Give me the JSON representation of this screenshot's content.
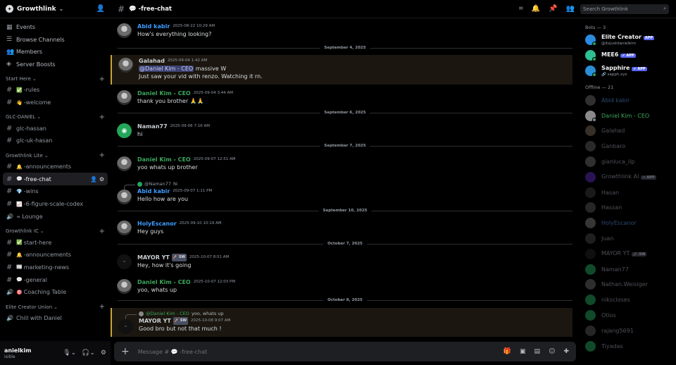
{
  "server": {
    "name": "Growthlink"
  },
  "nav": [
    {
      "label": "Events",
      "icon": "calendar-icon"
    },
    {
      "label": "Browse Channels",
      "icon": "browse-icon"
    },
    {
      "label": "Members",
      "icon": "members-icon"
    },
    {
      "label": "Server Boosts",
      "icon": "boost-icon"
    }
  ],
  "categories": [
    {
      "name": "Start Here",
      "channels": [
        {
          "name": "-rules",
          "emoji": "✅",
          "type": "text"
        },
        {
          "name": "-welcome",
          "emoji": "👋",
          "type": "text"
        }
      ]
    },
    {
      "name": "GLC-DANIEL",
      "channels": [
        {
          "name": "glc-hassan",
          "emoji": "",
          "type": "text"
        },
        {
          "name": "glc-uk-hasan",
          "emoji": "",
          "type": "text"
        }
      ]
    },
    {
      "name": "Growthlink Lite",
      "channels": [
        {
          "name": "-announcements",
          "emoji": "🔔",
          "type": "text"
        },
        {
          "name": "-free-chat",
          "emoji": "💬",
          "type": "text",
          "active": true
        },
        {
          "name": "-wins",
          "emoji": "💎",
          "type": "text"
        },
        {
          "name": "-6-figure-scale-codex",
          "emoji": "📈",
          "type": "text"
        },
        {
          "name": "Lounge",
          "emoji": "☕",
          "type": "voice"
        }
      ]
    },
    {
      "name": "Growthlink IC",
      "channels": [
        {
          "name": "start-here",
          "emoji": "✅",
          "type": "text"
        },
        {
          "name": "-announcements",
          "emoji": "🔔",
          "type": "text"
        },
        {
          "name": "marketing-news",
          "emoji": "📰",
          "type": "text"
        },
        {
          "name": "-general",
          "emoji": "💬",
          "type": "text"
        },
        {
          "name": "Coaching Table",
          "emoji": "🎯",
          "type": "voice"
        }
      ]
    },
    {
      "name": "Elite Creator Union",
      "channels": [
        {
          "name": "Chill with Daniel",
          "emoji": "",
          "type": "voice"
        }
      ]
    }
  ],
  "user": {
    "name": "anielkim",
    "status": "isible"
  },
  "header": {
    "channel_emoji": "💬",
    "channel_name": "-free-chat",
    "search_placeholder": "Search Growthlink"
  },
  "messages": [
    {
      "kind": "msg",
      "author": "Abid kabir",
      "color": "blue",
      "time": "2025-08-22 10:29 AM",
      "text": "How's everything looking?",
      "avatar": "photo"
    },
    {
      "kind": "sep",
      "text": "September 4, 2025"
    },
    {
      "kind": "msg",
      "author": "Galahad",
      "color": "gray",
      "time": "2025-09-04 1:42 AM",
      "mention": "@Daniel Kim - CEO",
      "text": " massive W",
      "text2": "Just saw your vid with renzo. Watching it rn.",
      "avatar": "photo",
      "highlight": true
    },
    {
      "kind": "msg",
      "author": "Daniel Kim - CEO",
      "color": "green",
      "time": "2025-09-04 3:44 AM",
      "text": "thank you brother 🙏🙏",
      "avatar": "photo"
    },
    {
      "kind": "sep",
      "text": "September 6, 2025"
    },
    {
      "kind": "msg",
      "author": "Naman77",
      "color": "gray",
      "time": "2025-09-06 7:16 AM",
      "text": "hi",
      "avatar": "green"
    },
    {
      "kind": "sep",
      "text": "September 7, 2025"
    },
    {
      "kind": "msg",
      "author": "Daniel Kim - CEO",
      "color": "green",
      "time": "2025-09-07 12:51 AM",
      "text": "yoo whats up brother",
      "avatar": "photo"
    },
    {
      "kind": "msg",
      "author": "Abid kabir",
      "color": "blue",
      "time": "2025-09-07 1:11 PM",
      "text": "Hello how are you",
      "avatar": "photo",
      "reply_author": "@Naman77",
      "reply_text": "hi",
      "reply_av": "green"
    },
    {
      "kind": "sep",
      "text": "September 10, 2025"
    },
    {
      "kind": "msg",
      "author": "HolyEscanor",
      "color": "blue",
      "time": "2025-09-10 10:19 AM",
      "text": "Hey guys",
      "avatar": "photo"
    },
    {
      "kind": "sep",
      "text": "October 7, 2025"
    },
    {
      "kind": "msg",
      "author": "MAYOR YT",
      "color": "gray",
      "badge": "🚀 SW",
      "time": "2025-10-07 8:51 AM",
      "text": "Hey, how it's going",
      "avatar": "dark"
    },
    {
      "kind": "msg",
      "author": "Daniel Kim - CEO",
      "color": "green",
      "time": "2025-10-07 12:03 PM",
      "text": "yoo, whats up",
      "avatar": "photo"
    },
    {
      "kind": "sep",
      "text": "October 8, 2025"
    },
    {
      "kind": "msg",
      "author": "MAYOR YT",
      "color": "gray",
      "badge": "🚀 SW",
      "time": "2025-10-08 9:07 AM",
      "text": "Good bro but not that much !",
      "avatar": "dark",
      "reply_author": "@Daniel Kim - CEO",
      "reply_text": "yoo, whats up",
      "reply_av": "photo",
      "highlight": true
    }
  ],
  "composer": {
    "placeholder": "Message # 💬 -free-chat"
  },
  "members": {
    "bots_label": "Bots — 3",
    "bots": [
      {
        "name": "Elite Creator",
        "badge": "APP",
        "sub": "@itsjustdanielkim",
        "color": "#2b8be0"
      },
      {
        "name": "MEE6",
        "badge": "✔ APP",
        "sub": "",
        "color": "#2fbf95"
      },
      {
        "name": "Sapphire",
        "badge": "✔ APP",
        "sub": "🔗 sapph.xyz",
        "color": "#2a8fd6"
      }
    ],
    "offline_label": "Offline — 21",
    "offline": [
      {
        "name": "Abid kabir",
        "color": "blue"
      },
      {
        "name": "Daniel Kim - CEO",
        "color": "active"
      },
      {
        "name": "Galahad",
        "color": "gray"
      },
      {
        "name": "Ganbaro",
        "color": "gray"
      },
      {
        "name": "gianluca_ilp",
        "color": "gray"
      },
      {
        "name": "Growthlink AI",
        "color": "gray",
        "badge": "✔ APP"
      },
      {
        "name": "Hasan",
        "color": "gray"
      },
      {
        "name": "Hassan",
        "color": "gray"
      },
      {
        "name": "HolyEscanor",
        "color": "blue"
      },
      {
        "name": "Juan",
        "color": "gray"
      },
      {
        "name": "MAYOR YT",
        "color": "gray",
        "badge": "🚀 SW"
      },
      {
        "name": "Naman77",
        "color": "gray"
      },
      {
        "name": "Nathan.Weisiger",
        "color": "gray"
      },
      {
        "name": "nikscloses",
        "color": "gray"
      },
      {
        "name": "Otios",
        "color": "gray"
      },
      {
        "name": "rajang5691",
        "color": "gray"
      },
      {
        "name": "Tiyadas",
        "color": "gray"
      }
    ]
  }
}
